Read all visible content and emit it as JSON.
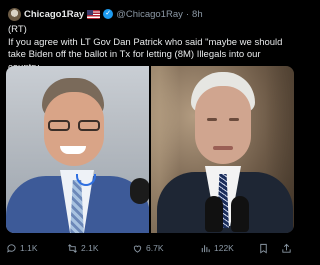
{
  "author": {
    "display_name": "Chicago1Ray",
    "handle": "@Chicago1Ray",
    "separator": "·",
    "time_ago": "8h"
  },
  "tweet": {
    "line1": "(RT)",
    "line2": "If you agree with LT Gov Dan Patrick who said \"maybe we should take Biden off the ballot in Tx for letting (8M) Illegals into our country"
  },
  "metrics": {
    "replies": "1.1K",
    "retweets": "2.1K",
    "likes": "6.7K",
    "views": "122K"
  },
  "icons": [
    "reply-icon",
    "retweet-icon",
    "like-icon",
    "views-icon",
    "bookmark-icon",
    "share-icon"
  ],
  "colors": {
    "background": "#000000",
    "text": "#e7e9ea",
    "muted": "#8b98a5",
    "verified": "#1d9bf0"
  }
}
